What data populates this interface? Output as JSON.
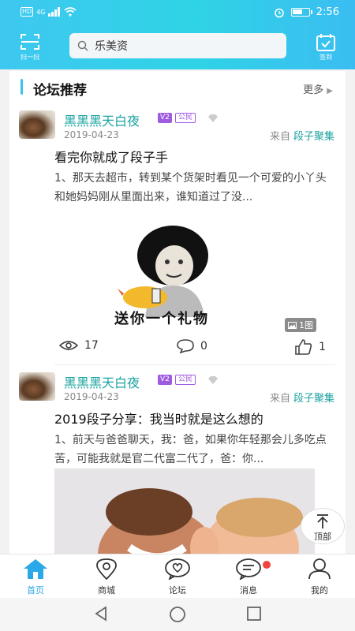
{
  "status_bar": {
    "network": "HD",
    "signal": "4G",
    "time": "2:56"
  },
  "header": {
    "scan_label": "扫一扫",
    "search_text": "乐美资",
    "signin_label": "签到"
  },
  "section": {
    "title": "论坛推荐",
    "more_label": "更多"
  },
  "posts": [
    {
      "username": "黑黑黑天白夜",
      "level": "V2",
      "rank": "公民",
      "date": "2019-04-23",
      "source_prefix": "来自",
      "source_name": "段子聚集",
      "title": "看完你就成了段子手",
      "excerpt": "1、那天去超市，转到某个货架时看见一个可爱的小丫头和她妈妈刚从里面出来，谁知道过了没...",
      "image_caption": "送你一个礼物",
      "image_count": "1图",
      "views": "17",
      "comments": "0",
      "likes": "1"
    },
    {
      "username": "黑黑黑天白夜",
      "level": "V2",
      "rank": "公民",
      "date": "2019-04-23",
      "source_prefix": "来自",
      "source_name": "段子聚集",
      "title": "2019段子分享：我当时就是这么想的",
      "excerpt": "1、前天与爸爸聊天，我：爸，如果你年轻那会儿多吃点苦，可能我就是官二代富二代了，爸：你..."
    }
  ],
  "back_to_top": "顶部",
  "tabs": [
    {
      "label": "首页",
      "icon": "home-icon",
      "active": true
    },
    {
      "label": "商城",
      "icon": "map-pin-icon",
      "active": false
    },
    {
      "label": "论坛",
      "icon": "heart-chat-icon",
      "active": false
    },
    {
      "label": "消息",
      "icon": "message-icon",
      "active": false
    },
    {
      "label": "我的",
      "icon": "user-icon",
      "active": false
    }
  ],
  "colors": {
    "accent": "#2aa8e8",
    "header_gradient_start": "#3ec8f0",
    "username": "#1aa3a0",
    "badge_purple": "#a05ce0",
    "notification_dot": "#f0443c"
  }
}
